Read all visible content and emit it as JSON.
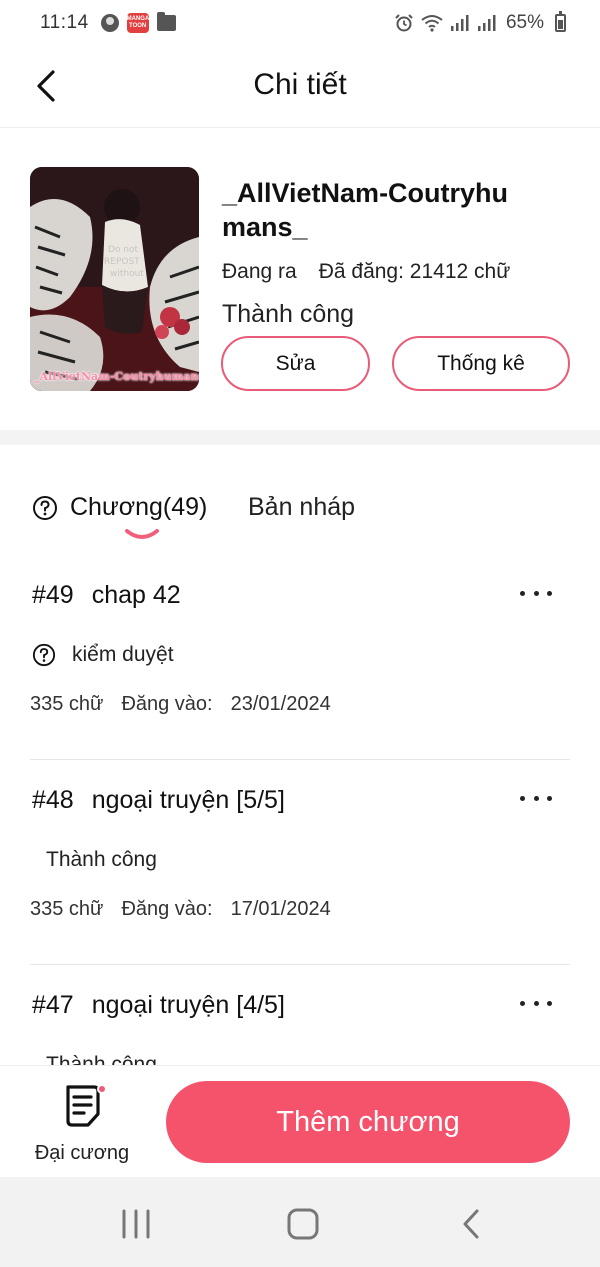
{
  "status_bar": {
    "time": "11:14",
    "app_badge": "MANGA TOON",
    "battery": "65%"
  },
  "header": {
    "title": "Chi tiết"
  },
  "story": {
    "title": "_AllVietNam-Coutryhumans_",
    "cover_caption": "_AllVietNam-Coutryhumans_",
    "state": "Đang ra",
    "word_count": "Đã đăng: 21412 chữ",
    "review_status": "Thành công",
    "edit_label": "Sửa",
    "stats_label": "Thống kê"
  },
  "tabs": [
    {
      "label": "Chương(49)",
      "active": true
    },
    {
      "label": "Bản nháp",
      "active": false
    }
  ],
  "chapters": [
    {
      "number": "#49",
      "title": "chap 42",
      "status": "kiểm duyệt",
      "words": "335 chữ",
      "posted_label": "Đăng vào:",
      "date": "23/01/2024"
    },
    {
      "number": "#48",
      "title": "ngoại truyện [5/5]",
      "status": "Thành công",
      "words": "335 chữ",
      "posted_label": "Đăng vào:",
      "date": "17/01/2024"
    },
    {
      "number": "#47",
      "title": "ngoại truyện [4/5]",
      "status": "Thành công",
      "words": "",
      "posted_label": "",
      "date": ""
    }
  ],
  "bottom_bar": {
    "outline_label": "Đại cương",
    "add_chapter_label": "Thêm chương"
  },
  "colors": {
    "accent": "#f5526b",
    "button_border": "#e85c77",
    "notification_dot": "#f05a78"
  },
  "icons": [
    "back-arrow-icon",
    "help-circle-icon",
    "more-horizontal-icon",
    "outline-document-icon",
    "recent-apps-icon",
    "home-icon",
    "system-back-icon",
    "alarm-icon",
    "wifi-icon",
    "signal-icon",
    "battery-icon"
  ]
}
